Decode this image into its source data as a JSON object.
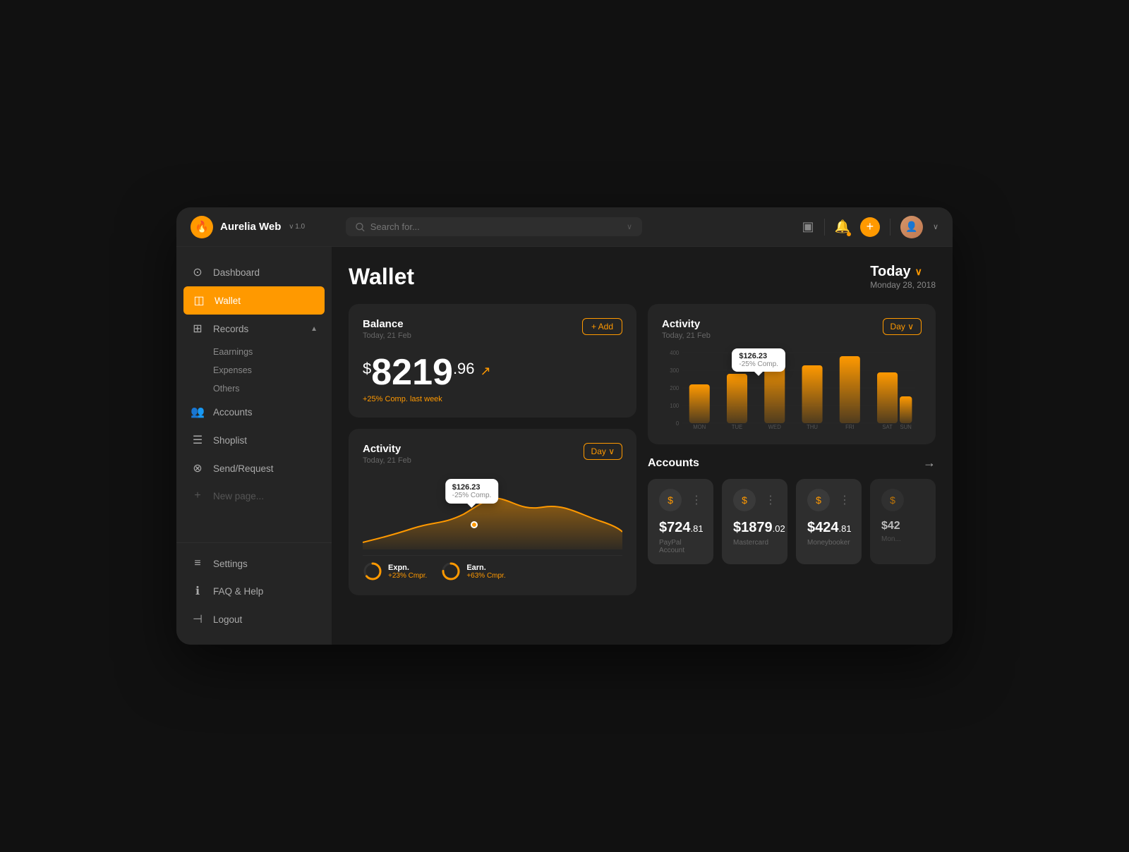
{
  "app": {
    "name": "Aurelia Web",
    "version": "v 1.0"
  },
  "header": {
    "search_placeholder": "Search for...",
    "add_label": "+",
    "today_label": "Today",
    "today_chevron": "∨",
    "date_sub": "Monday 28, 2018"
  },
  "sidebar": {
    "items": [
      {
        "id": "dashboard",
        "label": "Dashboard",
        "icon": "⊙"
      },
      {
        "id": "wallet",
        "label": "Wallet",
        "icon": "◫",
        "active": true
      },
      {
        "id": "records",
        "label": "Records",
        "icon": "⊞",
        "has_submenu": true,
        "chevron": "▲"
      },
      {
        "id": "accounts",
        "label": "Accounts",
        "icon": "⊕"
      },
      {
        "id": "shoplist",
        "label": "Shoplist",
        "icon": "☰"
      },
      {
        "id": "sendrequest",
        "label": "Send/Request",
        "icon": "⊗"
      },
      {
        "id": "newpage",
        "label": "New page...",
        "icon": "+"
      }
    ],
    "submenu": [
      "Eaarnings",
      "Expenses",
      "Others"
    ],
    "footer_items": [
      {
        "id": "settings",
        "label": "Settings",
        "icon": "≡"
      },
      {
        "id": "faq",
        "label": "FAQ & Help",
        "icon": "ℹ"
      },
      {
        "id": "logout",
        "label": "Logout",
        "icon": "⊣"
      }
    ]
  },
  "page": {
    "title": "Wallet",
    "balance": {
      "card_title": "Balance",
      "card_sub": "Today, 21 Feb",
      "add_label": "+ Add",
      "dollar_sign": "$",
      "main_amount": "8219",
      "cents": ".96",
      "arrow": "↗",
      "growth": "+25% Comp. last week"
    },
    "activity_small": {
      "card_title": "Activity",
      "card_sub": "Today, 21 Feb",
      "day_label": "Day ∨",
      "tooltip_amount": "$126.23",
      "tooltip_sub": "-25% Comp.",
      "stat1_label": "Expn.",
      "stat1_sub": "+23% Cmpr.",
      "stat2_label": "Earn.",
      "stat2_sub": "+63% Cmpr."
    },
    "activity_large": {
      "card_title": "Activity",
      "card_sub": "Today, 21 Feb",
      "day_label": "Day ∨",
      "tooltip_amount": "$126.23",
      "tooltip_sub": "-25% Comp.",
      "y_labels": [
        "400",
        "300",
        "200",
        "100",
        "0"
      ],
      "x_labels": [
        "MON",
        "TUE",
        "WED",
        "THU",
        "FRI",
        "SAT",
        "SUN"
      ],
      "bar_values": [
        55,
        70,
        90,
        85,
        95,
        75,
        40
      ]
    },
    "accounts": {
      "title": "Accounts",
      "items": [
        {
          "icon": "$",
          "amount": "$724",
          "cents": ".81",
          "name": "PayPal Account"
        },
        {
          "icon": "$",
          "amount": "$1879",
          "cents": ".02",
          "name": "Mastercard"
        },
        {
          "icon": "$",
          "amount": "$424",
          "cents": ".81",
          "name": "Moneybooker"
        },
        {
          "icon": "$",
          "amount": "$42",
          "cents": "",
          "name": "Mon..."
        }
      ]
    }
  },
  "colors": {
    "accent": "#f90",
    "bg_dark": "#1a1a1a",
    "bg_card": "#252525",
    "bg_sidebar": "#252525",
    "text_primary": "#fff",
    "text_secondary": "#888",
    "text_muted": "#555"
  }
}
